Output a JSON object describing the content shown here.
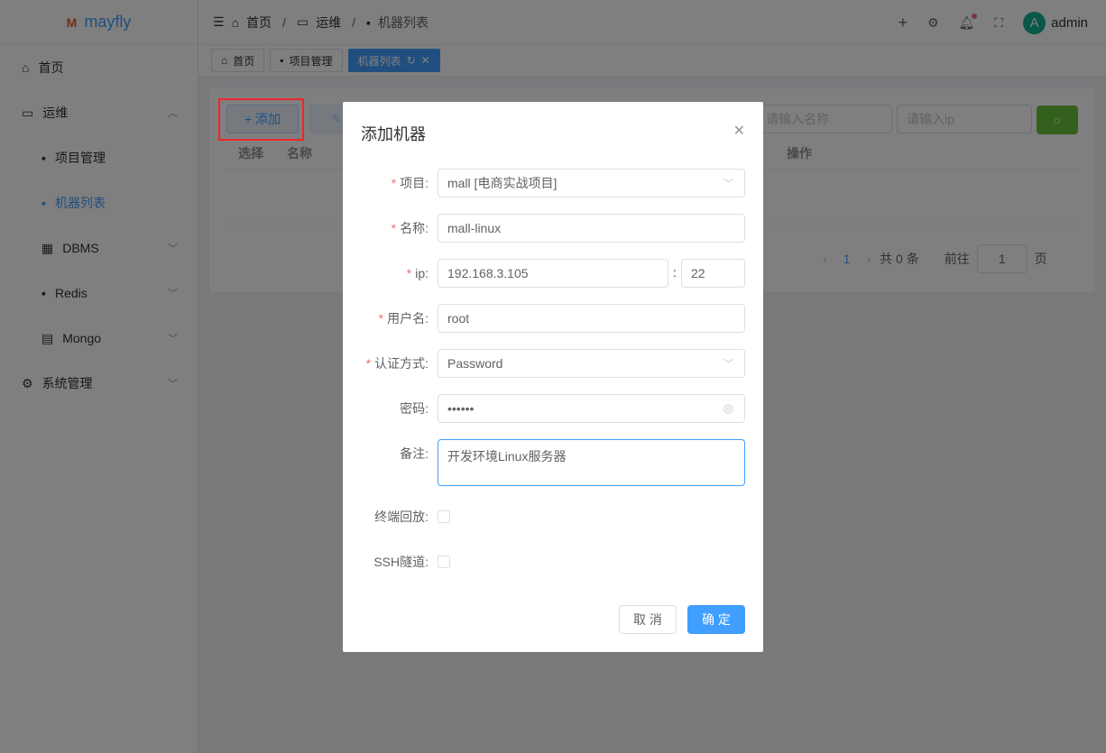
{
  "logo": {
    "text": "mayfly",
    "mark": "M"
  },
  "sidebar": {
    "items": [
      {
        "label": "首页"
      },
      {
        "label": "运维"
      },
      {
        "label": "项目管理"
      },
      {
        "label": "机器列表"
      },
      {
        "label": "DBMS"
      },
      {
        "label": "Redis"
      },
      {
        "label": "Mongo"
      },
      {
        "label": "系统管理"
      }
    ]
  },
  "breadcrumb": [
    "首页",
    "运维",
    "机器列表"
  ],
  "header": {
    "user": "admin",
    "avatar": "A"
  },
  "tabs": [
    "首页",
    "项目管理",
    "机器列表"
  ],
  "toolbar": {
    "add": "添加",
    "name_placeholder": "请输入名称",
    "ip_placeholder": "请输入ip"
  },
  "table": {
    "headers": [
      "选择",
      "名称",
      "操作"
    ]
  },
  "pagination": {
    "page": "1",
    "total": "共 0 条",
    "goto": "前往",
    "goto_value": "1",
    "page_unit": "页"
  },
  "dialog": {
    "title": "添加机器",
    "fields": {
      "project": {
        "label": "项目:",
        "value": "mall [电商实战项目]"
      },
      "name": {
        "label": "名称:",
        "value": "mall-linux"
      },
      "ip": {
        "label": "ip:",
        "value": "192.168.3.105",
        "port": "22",
        "sep": ":"
      },
      "username": {
        "label": "用户名:",
        "value": "root"
      },
      "auth": {
        "label": "认证方式:",
        "value": "Password"
      },
      "password": {
        "label": "密码:",
        "value": "••••••"
      },
      "remark": {
        "label": "备注:",
        "value": "开发环境Linux服务器"
      },
      "replay": {
        "label": "终端回放:"
      },
      "ssh": {
        "label": "SSH隧道:"
      }
    },
    "cancel": "取 消",
    "confirm": "确 定"
  },
  "colors": {
    "primary": "#409eff",
    "success": "#67c23a",
    "danger": "#f56c6c"
  }
}
